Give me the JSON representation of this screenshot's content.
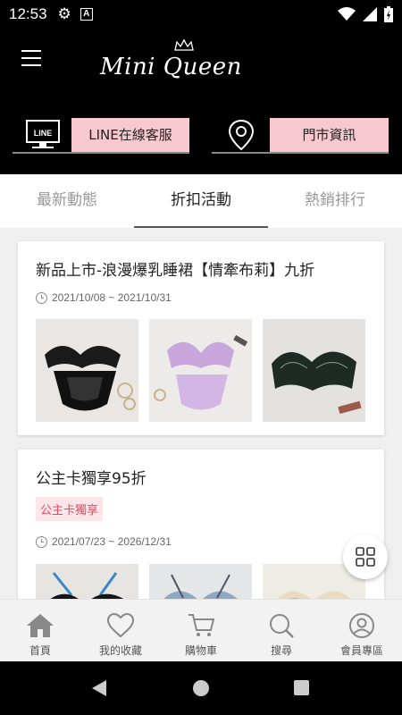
{
  "status_bar": {
    "time": "12:53"
  },
  "header": {
    "logo_text": "Mini Queen",
    "line_button_label": "LINE在線客服",
    "line_icon_text": "LINE",
    "store_button_label": "門市資訊"
  },
  "tabs": [
    {
      "label": "最新動態",
      "active": false
    },
    {
      "label": "折扣活動",
      "active": true
    },
    {
      "label": "熱銷排行",
      "active": false
    }
  ],
  "promotions": [
    {
      "title": "新品上市-浪漫爆乳睡裙【情牽布莉】九折",
      "date_range": "2021/10/08 ~ 2021/10/31",
      "thumbnails": [
        "black-lace-bra-set",
        "lilac-bra-set",
        "dark-green-lace-bra"
      ]
    },
    {
      "title": "公主卡獨享95折",
      "badge": "公主卡獨享",
      "date_range": "2021/07/23 ~ 2026/12/31",
      "thumbnails": [
        "black-blue-bra",
        "blue-floral-bra",
        "cream-bra"
      ]
    }
  ],
  "bottom_nav": [
    {
      "label": "首頁",
      "icon": "home-icon"
    },
    {
      "label": "我的收藏",
      "icon": "heart-icon"
    },
    {
      "label": "購物車",
      "icon": "cart-icon"
    },
    {
      "label": "搜尋",
      "icon": "search-icon"
    },
    {
      "label": "會員專區",
      "icon": "user-icon"
    }
  ],
  "colors": {
    "accent_pink": "#f8c8d0",
    "badge_text": "#e34b63",
    "badge_bg": "#fde6e9"
  }
}
